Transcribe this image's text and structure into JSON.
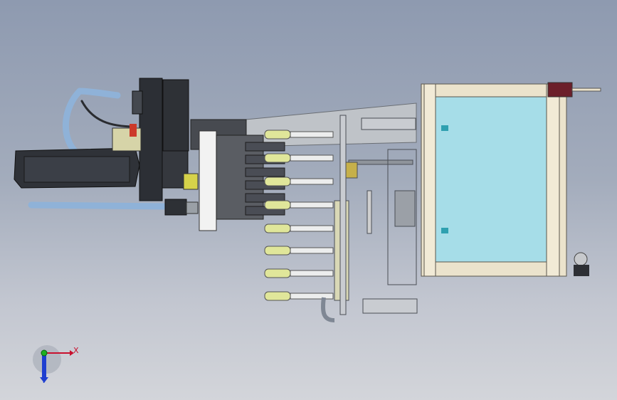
{
  "window": {
    "view": "cad-assembly-top-view",
    "background_top": "#8e9ab0",
    "background_bottom": "#d3d5da"
  },
  "triad": {
    "x_label": "X",
    "y_label": "Y",
    "x_color": "#c8102e",
    "y_color": "#1f3fd0",
    "origin_color": "#1fb020"
  },
  "model": {
    "frame_color": "#ebe3cc",
    "glass_color": "#a6dde8",
    "cylinder_color": "#e0e69a",
    "dark_part_color": "#3a3d45",
    "hose_color": "#8fb2d8"
  }
}
